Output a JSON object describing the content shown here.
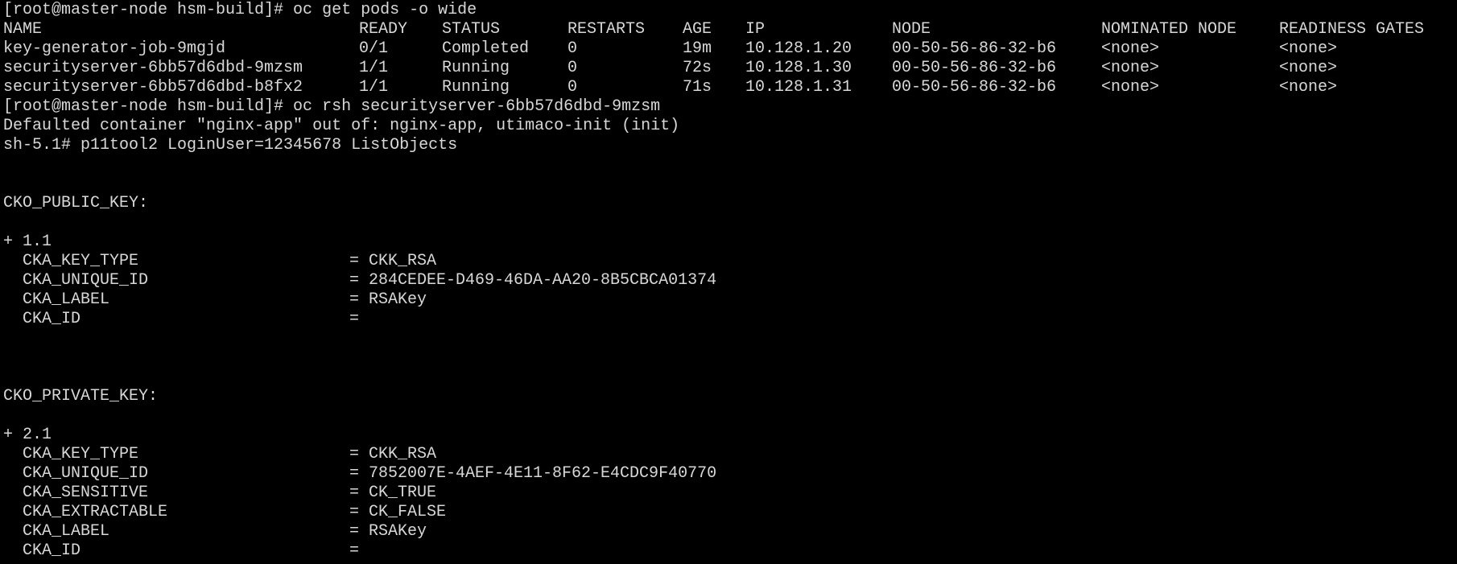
{
  "colors": {
    "background": "#000000",
    "foreground": "#d8d8d8"
  },
  "prompt1": "[root@master-node hsm-build]# oc get pods -o wide",
  "pods": {
    "headers": [
      "NAME",
      "READY",
      "STATUS",
      "RESTARTS",
      "AGE",
      "IP",
      "NODE",
      "NOMINATED NODE",
      "READINESS GATES"
    ],
    "rows": [
      [
        "key-generator-job-9mgjd",
        "0/1",
        "Completed",
        "0",
        "19m",
        "10.128.1.20",
        "00-50-56-86-32-b6",
        "<none>",
        "<none>"
      ],
      [
        "securityserver-6bb57d6dbd-9mzsm",
        "1/1",
        "Running",
        "0",
        "72s",
        "10.128.1.30",
        "00-50-56-86-32-b6",
        "<none>",
        "<none>"
      ],
      [
        "securityserver-6bb57d6dbd-b8fx2",
        "1/1",
        "Running",
        "0",
        "71s",
        "10.128.1.31",
        "00-50-56-86-32-b6",
        "<none>",
        "<none>"
      ]
    ]
  },
  "prompt2": "[root@master-node hsm-build]# oc rsh securityserver-6bb57d6dbd-9mzsm",
  "defaulted": "Defaulted container \"nginx-app\" out of: nginx-app, utimaco-init (init)",
  "prompt3": "sh-5.1# p11tool2 LoginUser=12345678 ListObjects",
  "public": {
    "header": "CKO_PUBLIC_KEY:",
    "object": "+ 1.1",
    "attrs": [
      [
        "  CKA_KEY_TYPE",
        "= CKK_RSA"
      ],
      [
        "  CKA_UNIQUE_ID",
        "= 284CEDEE-D469-46DA-AA20-8B5CBCA01374"
      ],
      [
        "  CKA_LABEL",
        "= RSAKey"
      ],
      [
        "  CKA_ID",
        "="
      ]
    ]
  },
  "private": {
    "header": "CKO_PRIVATE_KEY:",
    "object": "+ 2.1",
    "attrs": [
      [
        "  CKA_KEY_TYPE",
        "= CKK_RSA"
      ],
      [
        "  CKA_UNIQUE_ID",
        "= 7852007E-4AEF-4E11-8F62-E4CDC9F40770"
      ],
      [
        "  CKA_SENSITIVE",
        "= CK_TRUE"
      ],
      [
        "  CKA_EXTRACTABLE",
        "= CK_FALSE"
      ],
      [
        "  CKA_LABEL",
        "= RSAKey"
      ],
      [
        "  CKA_ID",
        "="
      ]
    ]
  }
}
